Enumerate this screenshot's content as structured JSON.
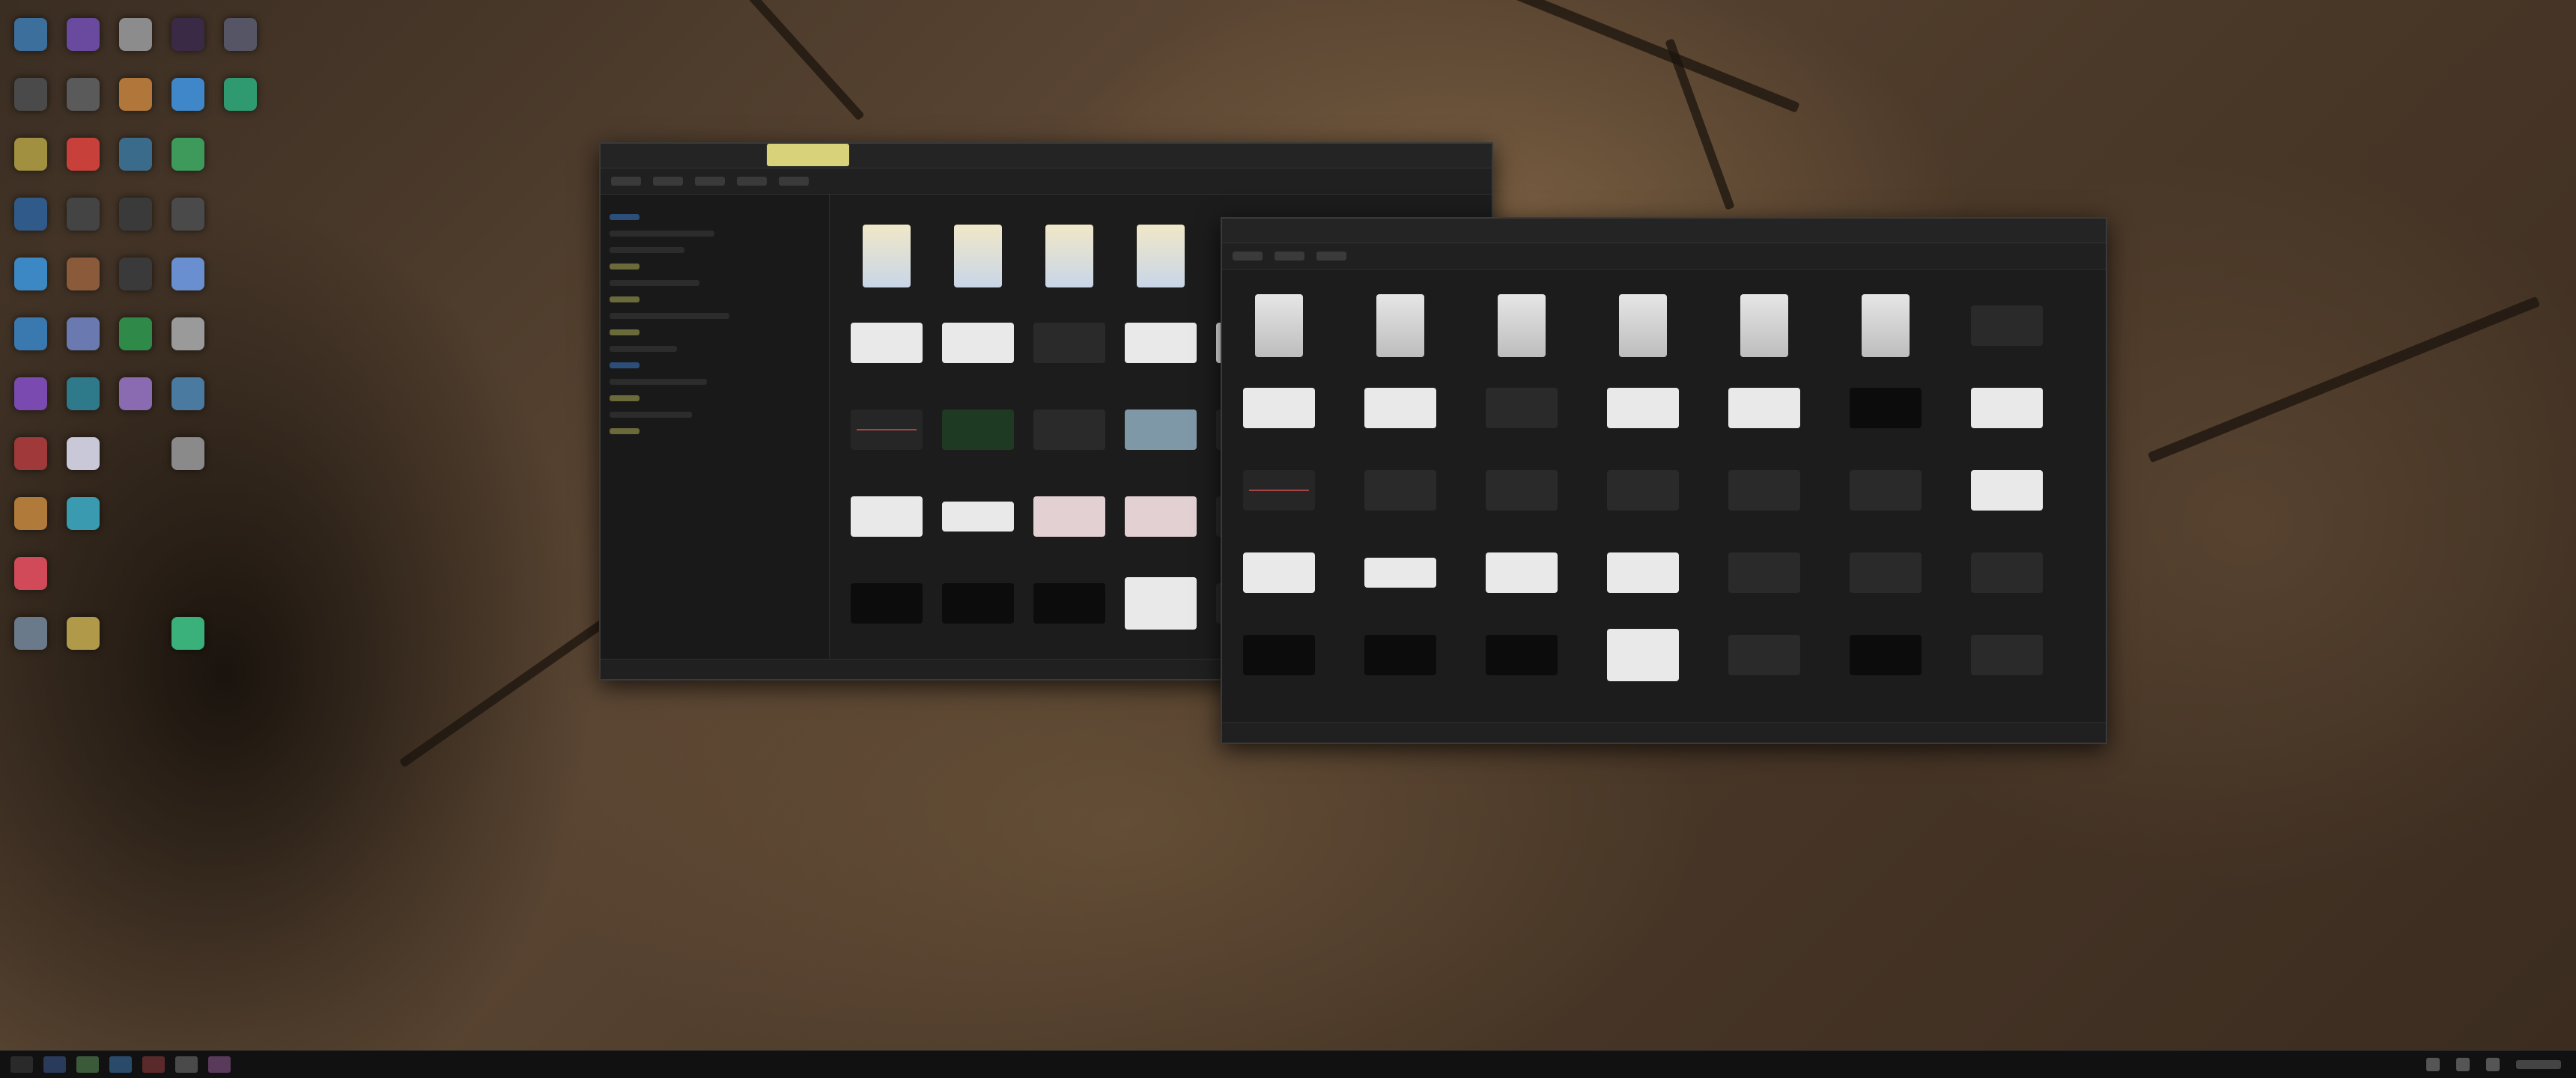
{
  "window_a": {
    "title": "",
    "status": ""
  },
  "window_b": {
    "title": "",
    "status": ""
  },
  "taskbar": {
    "clock": ""
  },
  "colors": {
    "accent": "#d8d27a",
    "window_bg": "#1c1c1c",
    "taskbar_bg": "#111111"
  },
  "icons": {
    "desktop": [
      "app-icon"
    ],
    "thumbnails": [
      "file-icon",
      "image-thumbnail"
    ],
    "tray": [
      "network-icon",
      "volume-icon",
      "notification-icon"
    ]
  }
}
